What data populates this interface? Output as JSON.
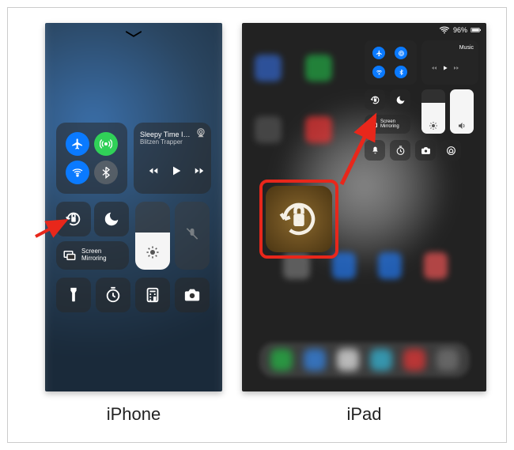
{
  "labels": {
    "iphone": "iPhone",
    "ipad": "iPad"
  },
  "iphone": {
    "music": {
      "title": "Sleepy Time In…",
      "artist": "Blitzen Trapper"
    },
    "screen_mirroring_label": "Screen\nMirroring",
    "brightness_pct": 55
  },
  "ipad": {
    "status": {
      "battery_text": "96%",
      "wifi_icon": "wifi-icon",
      "battery_icon": "battery-icon"
    },
    "music_label": "Music",
    "screen_mirroring_label": "Screen\nMirroring",
    "brightness_pct": 70,
    "volume_pct": 100
  },
  "highlight": {
    "feature": "rotation-lock"
  }
}
